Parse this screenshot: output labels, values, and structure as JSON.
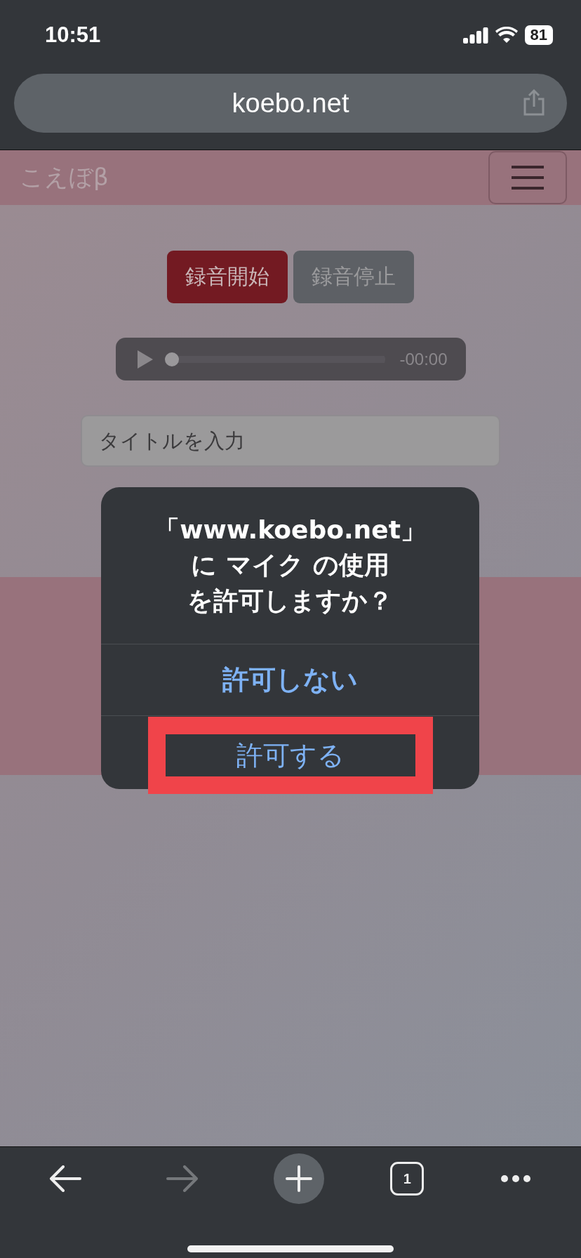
{
  "status_bar": {
    "time": "10:51",
    "battery": "81"
  },
  "address_bar": {
    "url": "koebo.net"
  },
  "site_header": {
    "logo": "こえぼβ"
  },
  "recorder": {
    "buttons": [
      {
        "label": "録音開始",
        "kind": "start"
      },
      {
        "label": "録音停止",
        "kind": "stop"
      }
    ],
    "player": {
      "time": "-00:00",
      "level": 0
    },
    "title_field": {
      "placeholder": "タイトルを入力"
    }
  },
  "dialog": {
    "message": [
      "「www.koebo.net」",
      "に マイク の使用",
      "を許可しますか？"
    ],
    "buttons": [
      {
        "label": "許可しない",
        "bold": true,
        "annotated": false
      },
      {
        "label": "許可する",
        "bold": false,
        "annotated": true
      }
    ]
  },
  "toolbar": {
    "tab_count": "1"
  }
}
